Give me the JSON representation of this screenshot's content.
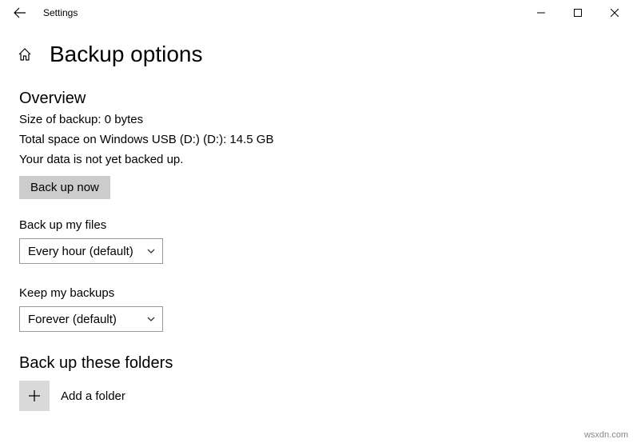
{
  "window": {
    "app_title": "Settings"
  },
  "page": {
    "title": "Backup options"
  },
  "overview": {
    "heading": "Overview",
    "size_line": "Size of backup: 0 bytes",
    "space_line": "Total space on Windows USB (D:) (D:): 14.5 GB",
    "status_line": "Your data is not yet backed up.",
    "button": "Back up now"
  },
  "frequency": {
    "label": "Back up my files",
    "value": "Every hour (default)"
  },
  "retention": {
    "label": "Keep my backups",
    "value": "Forever (default)"
  },
  "folders": {
    "heading": "Back up these folders",
    "add_label": "Add a folder"
  },
  "watermark": "wsxdn.com"
}
